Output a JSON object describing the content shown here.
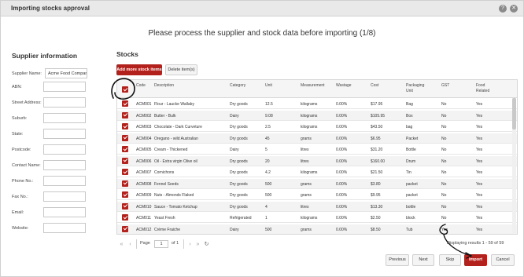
{
  "window": {
    "title": "Importing stocks approval",
    "heading": "Please process the supplier and stock data before importing (1/8)",
    "icons": [
      "help-icon",
      "close-icon"
    ]
  },
  "supplier": {
    "title": "Supplier information",
    "fields": [
      {
        "label": "Supplier Name:",
        "value": "Acme Food Company"
      },
      {
        "label": "ABN:",
        "value": ""
      },
      {
        "label": "Street Address:",
        "value": ""
      },
      {
        "label": "Suburb:",
        "value": ""
      },
      {
        "label": "State:",
        "value": ""
      },
      {
        "label": "Postcode:",
        "value": ""
      },
      {
        "label": "Contact Name:",
        "value": ""
      },
      {
        "label": "Phone No.:",
        "value": ""
      },
      {
        "label": "Fax No.:",
        "value": ""
      },
      {
        "label": "Email:",
        "value": ""
      },
      {
        "label": "Website:",
        "value": ""
      }
    ]
  },
  "stocks": {
    "title": "Stocks",
    "add_label": "Add more stock items",
    "delete_label": "Delete item(s)",
    "columns": [
      "Code",
      "Description",
      "Category",
      "Unit",
      "Measurement",
      "Wastage",
      "Cost",
      "Packaging Unit",
      "GST",
      "Food Related"
    ],
    "rows": [
      [
        "ACM001",
        "Flour - Laucke Wallaby",
        "Dry goods",
        "12.5",
        "kilograms",
        "0.00%",
        "$17.95",
        "Bag",
        "No",
        "Yes"
      ],
      [
        "ACM002",
        "Butter - Bulk",
        "Dairy",
        "9.08",
        "kilograms",
        "0.00%",
        "$105.95",
        "Box",
        "No",
        "Yes"
      ],
      [
        "ACM003",
        "Chocolate - Dark Curveture",
        "Dry goods",
        "2.5",
        "kilograms",
        "0.00%",
        "$43.50",
        "bag",
        "No",
        "Yes"
      ],
      [
        "ACM004",
        "Oregano - wild Australian",
        "Dry goods",
        "45",
        "grams",
        "0.00%",
        "$6.95",
        "Packet",
        "No",
        "Yes"
      ],
      [
        "ACM005",
        "Cream - Thickened",
        "Dairy",
        "5",
        "litres",
        "0.00%",
        "$31.20",
        "Bottle",
        "No",
        "Yes"
      ],
      [
        "ACM006",
        "Oil - Extra virgin Olive oil",
        "Dry goods",
        "20",
        "litres",
        "0.00%",
        "$160.00",
        "Drum",
        "No",
        "Yes"
      ],
      [
        "ACM007",
        "Cornichons",
        "Dry goods",
        "4.2",
        "kilograms",
        "0.00%",
        "$21.50",
        "Tin",
        "No",
        "Yes"
      ],
      [
        "ACM008",
        "Fennel Seeds",
        "Dry goods",
        "500",
        "grams",
        "0.00%",
        "$3.80",
        "packet",
        "No",
        "Yes"
      ],
      [
        "ACM009",
        "Nuts - Almonds Flaked",
        "Dry goods",
        "500",
        "grams",
        "0.00%",
        "$9.95",
        "packet",
        "No",
        "Yes"
      ],
      [
        "ACM010",
        "Sauce - Tomato Ketchup",
        "Dry goods",
        "4",
        "litres",
        "0.00%",
        "$13.30",
        "bottle",
        "No",
        "Yes"
      ],
      [
        "ACM011",
        "Yeast Fresh",
        "Refrigerated",
        "1",
        "kilograms",
        "0.00%",
        "$2.50",
        "block",
        "No",
        "Yes"
      ],
      [
        "ACM012",
        "Crème Fraiche",
        "Dairy",
        "500",
        "grams",
        "0.00%",
        "$8.50",
        "Tub",
        "Yes",
        "Yes"
      ]
    ]
  },
  "pager": {
    "page_label": "Page",
    "page_value": "1",
    "of_label": "of 1",
    "display_text": "Displaying results 1 - 59 of 59"
  },
  "footer": {
    "previous": "Previous",
    "next": "Next",
    "skip": "Skip",
    "import": "Import",
    "cancel": "Cancel"
  },
  "colors": {
    "accent": "#b3211c",
    "titlebar": "#e9e9e9"
  }
}
